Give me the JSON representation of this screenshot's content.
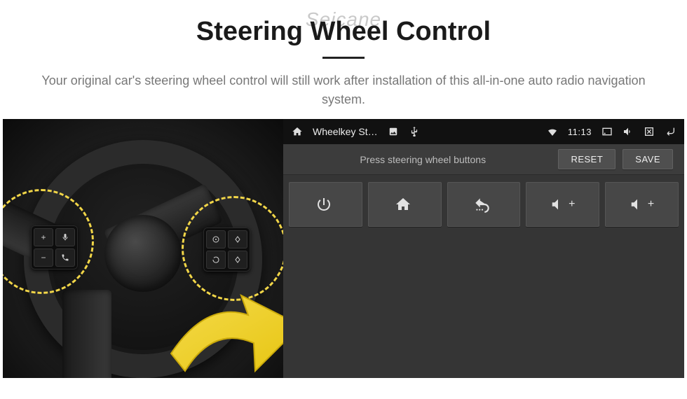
{
  "header": {
    "watermark": "Seicane",
    "title": "Steering Wheel Control",
    "subtitle": "Your original car's steering wheel control will still work after installation of this all-in-one auto radio navigation system."
  },
  "wheel": {
    "left_buttons": [
      "+",
      "voice",
      "−",
      "phone"
    ],
    "right_buttons": [
      "src",
      "up",
      "loop",
      "down"
    ]
  },
  "unit": {
    "status": {
      "home_icon": "home",
      "app_title": "Wheelkey St…",
      "tray_icons": [
        "picture",
        "usb"
      ],
      "right_icons": [
        "wifi"
      ],
      "clock": "11:13",
      "far_icons": [
        "cast",
        "mute",
        "close",
        "return"
      ]
    },
    "toolbar": {
      "hint": "Press steering wheel buttons",
      "reset_label": "RESET",
      "save_label": "SAVE"
    },
    "tiles": [
      {
        "icon": "power",
        "label": ""
      },
      {
        "icon": "home",
        "label": ""
      },
      {
        "icon": "back",
        "label": ""
      },
      {
        "icon": "volume-up",
        "label": "+"
      },
      {
        "icon": "volume-up",
        "label": "+"
      }
    ]
  }
}
